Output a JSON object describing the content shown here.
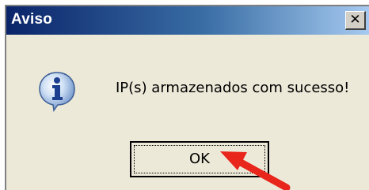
{
  "dialog": {
    "title": "Aviso",
    "close_glyph": "✕",
    "message": "IP(s) armazenados com sucesso!",
    "ok_label": "OK",
    "icon": "information-icon"
  },
  "annotation": {
    "arrow_color": "#e8261c",
    "pointing_to": "OK"
  },
  "colors": {
    "titlebar_start": "#0a246a",
    "titlebar_end": "#a6caf0",
    "dialog_bg": "#ece9d8"
  }
}
